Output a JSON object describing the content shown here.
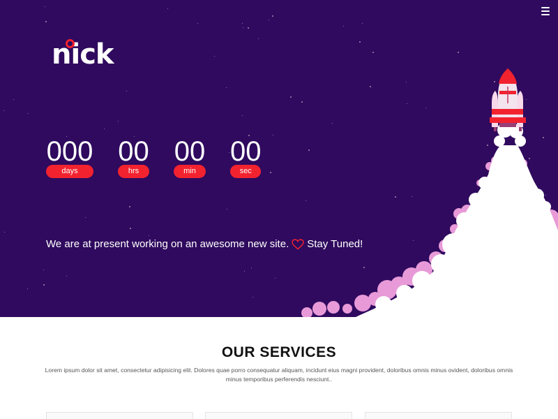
{
  "hero": {
    "logo_text": "nick",
    "countdown": [
      {
        "value": "000",
        "label": "days"
      },
      {
        "value": "00",
        "label": "hrs"
      },
      {
        "value": "00",
        "label": "min"
      },
      {
        "value": "00",
        "label": "sec"
      }
    ],
    "tagline_before": "We are at present working on an awesome new site.",
    "tagline_after": "Stay Tuned!"
  },
  "services": {
    "title": "OUR SERVICES",
    "description": "Lorem ipsum dolor sit amet, consectetur adipisicing elit. Dolores quae porro consequatur aliquam, incidunt eius magni provident, doloribus omnis minus ovident, doloribus omnis minus temporibus perferendis nesciunt.."
  },
  "icons": {
    "menu": "hamburger-menu-icon",
    "heart": "heart-outline-icon",
    "rocket": "rocket-illustration"
  },
  "colors": {
    "hero_background": "#2f0a5e",
    "accent": "#f3222f",
    "smoke": "#ffffff",
    "smoke_pink": "#e89ad8"
  }
}
